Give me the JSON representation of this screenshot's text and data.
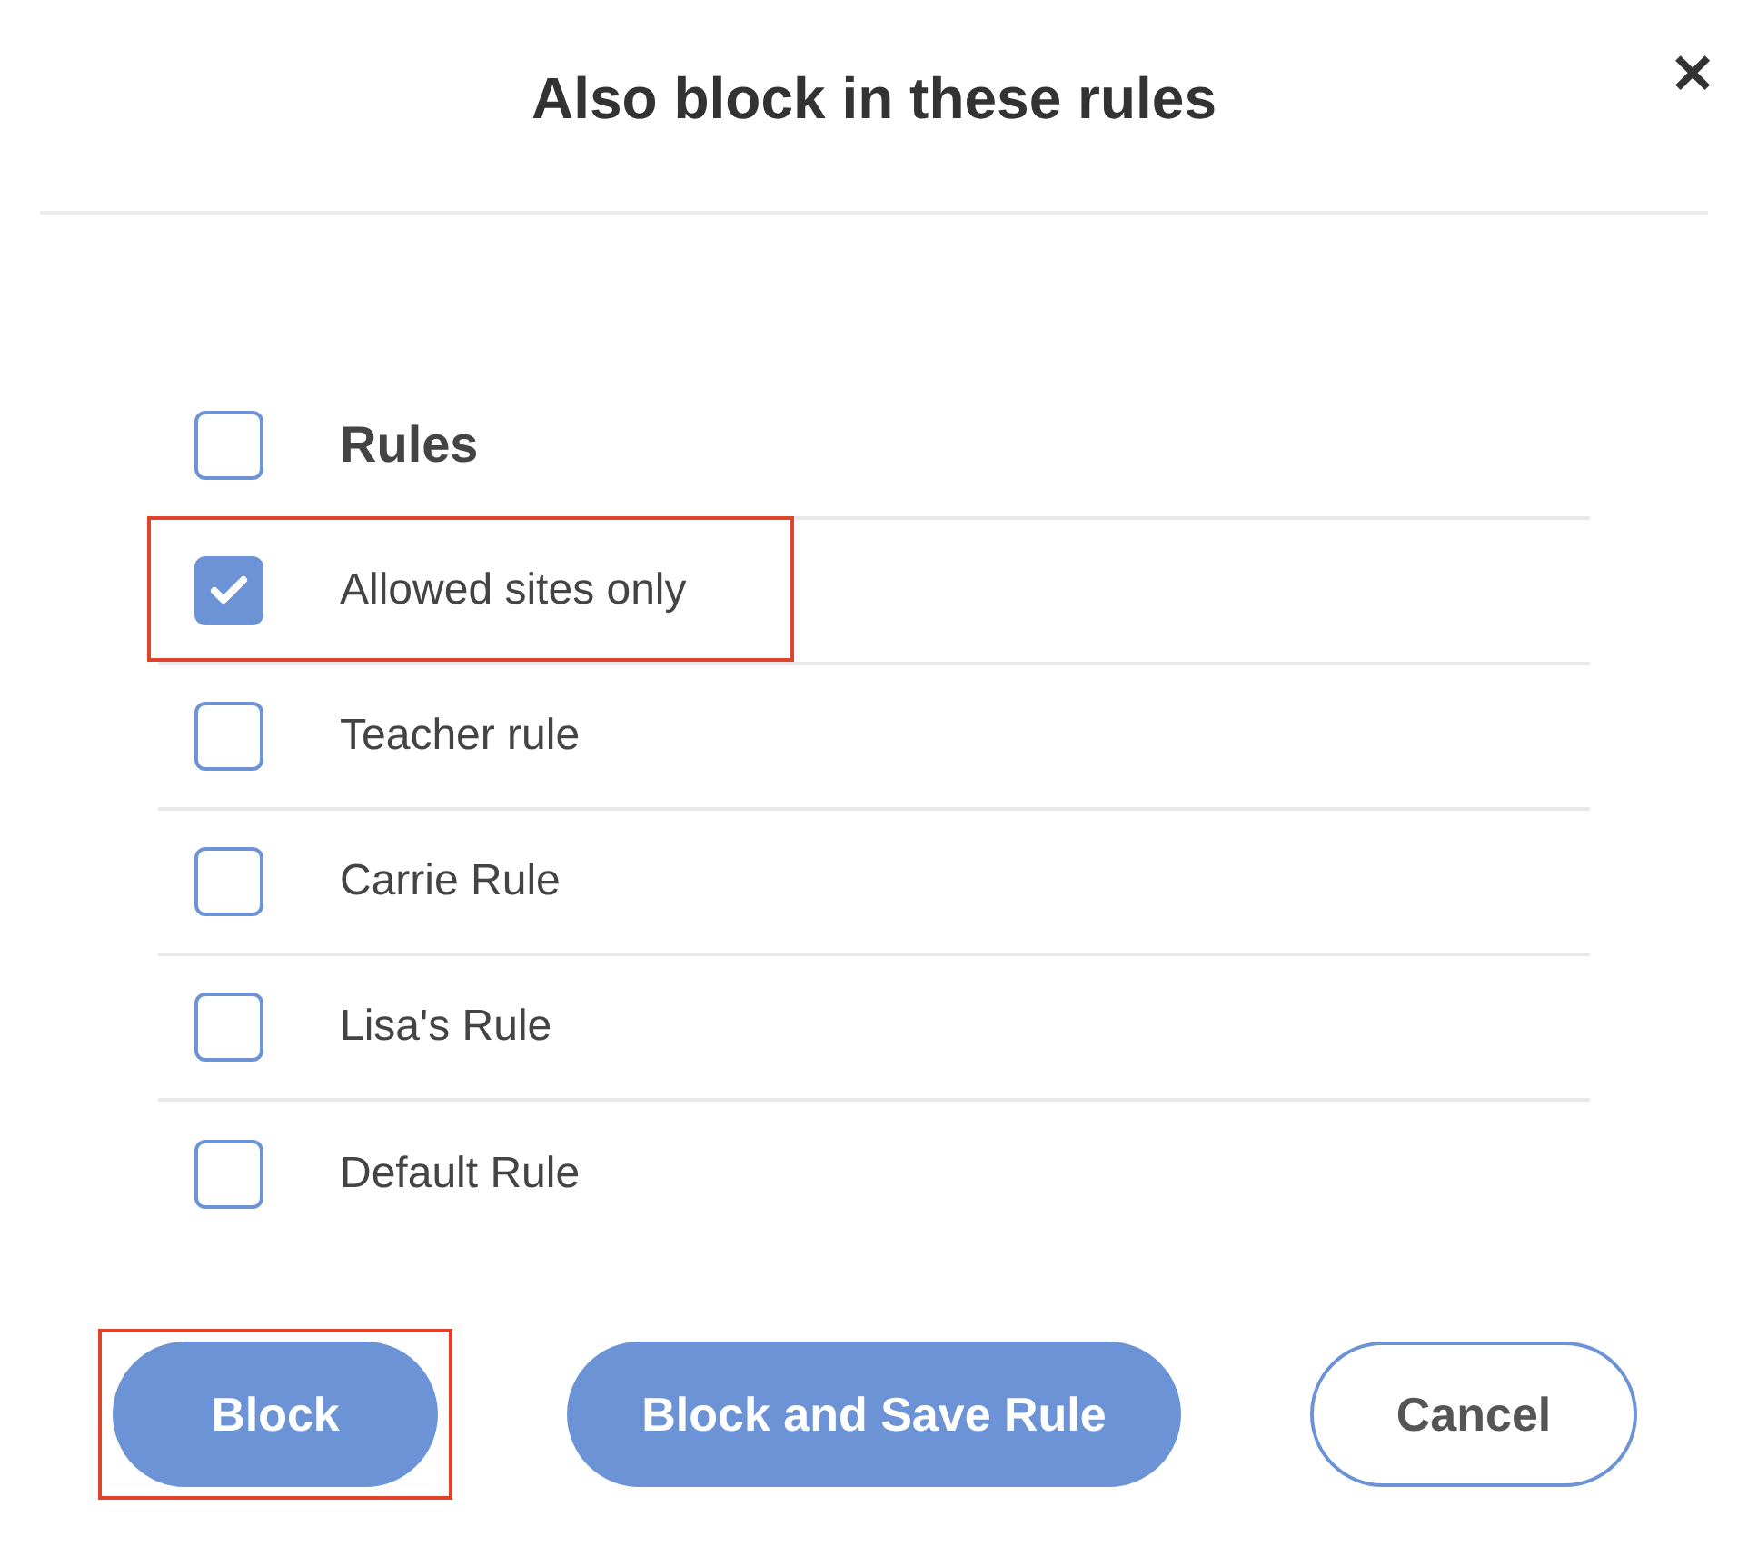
{
  "dialog": {
    "title": "Also block in these rules",
    "close": "✕"
  },
  "rules_header": {
    "label": "Rules",
    "checked": false
  },
  "rules": [
    {
      "label": "Allowed sites only",
      "checked": true,
      "highlighted": true
    },
    {
      "label": "Teacher rule",
      "checked": false,
      "highlighted": false
    },
    {
      "label": "Carrie Rule",
      "checked": false,
      "highlighted": false
    },
    {
      "label": "Lisa's Rule",
      "checked": false,
      "highlighted": false
    },
    {
      "label": "Default Rule",
      "checked": false,
      "highlighted": false
    }
  ],
  "buttons": [
    {
      "label": "Block",
      "kind": "primary",
      "highlighted": true
    },
    {
      "label": "Block and Save Rule",
      "kind": "primary",
      "highlighted": false
    },
    {
      "label": "Cancel",
      "kind": "outline",
      "highlighted": false
    }
  ]
}
